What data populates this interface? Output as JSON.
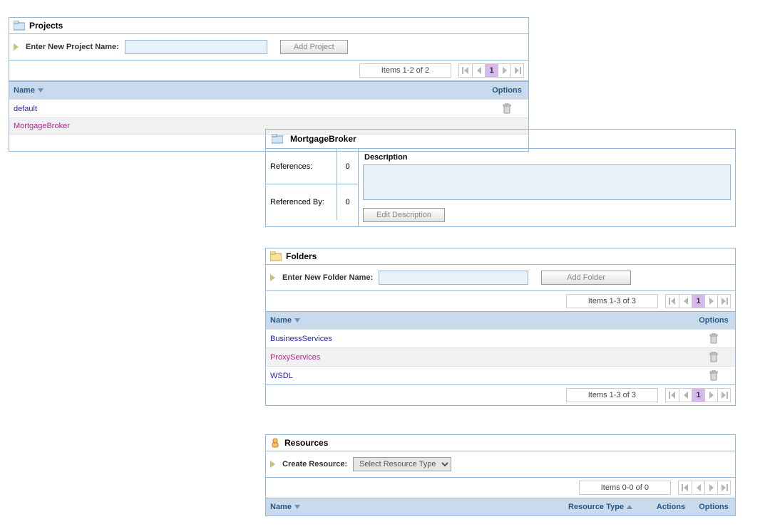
{
  "projects": {
    "title": "Projects",
    "enter_label": "Enter New Project Name:",
    "add_button": "Add Project",
    "pager_info": "Items 1-2 of 2",
    "page_num": "1",
    "columns": {
      "name": "Name",
      "options": "Options"
    },
    "rows": [
      {
        "name": "default",
        "selected": false
      },
      {
        "name": "MortgageBroker",
        "selected": true
      }
    ]
  },
  "detail": {
    "title": "MortgageBroker",
    "references_label": "References:",
    "references_value": "0",
    "referenced_by_label": "Referenced By:",
    "referenced_by_value": "0",
    "description_label": "Description",
    "edit_button": "Edit Description"
  },
  "folders": {
    "title": "Folders",
    "enter_label": "Enter New Folder Name:",
    "add_button": "Add Folder",
    "pager_info": "Items 1-3 of 3",
    "page_num": "1",
    "columns": {
      "name": "Name",
      "options": "Options"
    },
    "rows": [
      {
        "name": "BusinessServices",
        "selected": false
      },
      {
        "name": "ProxyServices",
        "selected": true
      },
      {
        "name": "WSDL",
        "selected": false
      }
    ]
  },
  "resources": {
    "title": "Resources",
    "create_label": "Create Resource:",
    "select_placeholder": "Select Resource Type",
    "pager_info": "Items 0-0 of 0",
    "columns": {
      "name": "Name",
      "type": "Resource Type",
      "actions": "Actions",
      "options": "Options"
    }
  }
}
